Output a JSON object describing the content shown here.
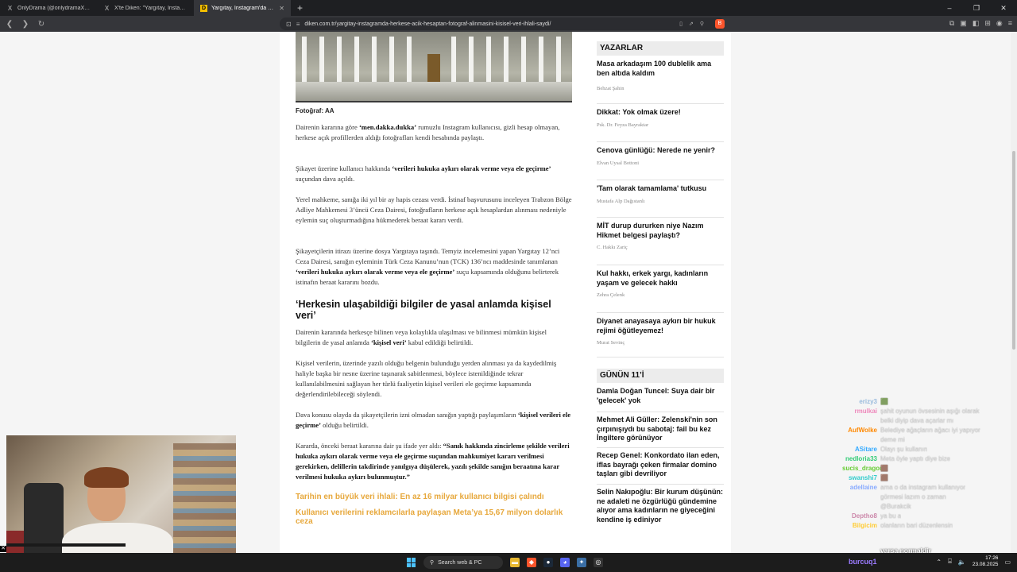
{
  "browser": {
    "tabs": [
      {
        "label": "OnlyDrama (@onlydramaX) / X",
        "icon": "X"
      },
      {
        "label": "X'te Diken: \"Yargıtay, Instagram'da h...",
        "icon": "X"
      },
      {
        "label": "Yargıtay, Instagram'da herkese a...",
        "icon": "D",
        "active": true
      }
    ],
    "new_tab": "+",
    "window_controls": [
      "–",
      "❐",
      "✕"
    ],
    "url": "diken.com.tr/yargitay-instagramda-herkese-acik-hesaptan-fotograf-alinmasini-kisisel-veri-ihlali-saydi/",
    "brave_badge": "B"
  },
  "article": {
    "photo_caption": "Fotoğraf: AA",
    "paragraphs": [
      {
        "pre": "Dairenin kararına göre ",
        "bold": "‘men.dakka.dukka’",
        "post": " rumuzlu Instagram kullanıcısı, gizli hesap olmayan, herkese açık profillerden aldığı fotoğrafları kendi hesabında paylaştı."
      },
      {
        "pre": "Şikayet üzerine kullanıcı hakkında ",
        "bold": "‘verileri hukuka aykırı olarak verme veya ele geçirme’",
        "post": " suçundan dava açıldı."
      },
      {
        "pre": "Yerel mahkeme, sanığa iki yıl bir ay hapis cezası verdi. İstinaf başvurusunu inceleyen Trabzon Bölge Adliye Mahkemesi 3’üncü Ceza Dairesi, fotoğrafların herkese açık hesaplardan alınması nedeniyle eylemin suç oluşturmadığına hükmederek beraat kararı verdi.",
        "bold": "",
        "post": ""
      },
      {
        "pre": "Şikayetçilerin itirazı üzerine dosya Yargıtaya taşındı. Temyiz incelemesini yapan Yargıtay 12’nci Ceza Dairesi, sanığın eyleminin Türk Ceza Kanunu’nun (TCK) 136’ncı maddesinde tanımlanan ",
        "bold": "‘verileri hukuka aykırı olarak verme veya ele geçirme’",
        "post": " suçu kapsamında olduğunu belirterek istinafın beraat kararını bozdu."
      }
    ],
    "heading": "‘Herkesin ulaşabildiği bilgiler de yasal anlamda kişisel veri’",
    "paragraphs2": [
      {
        "pre": "Dairenin kararında herkesçe bilinen veya kolaylıkla ulaşılması ve bilinmesi mümkün kişisel bilgilerin de yasal anlamda ",
        "bold": "‘kişisel veri’",
        "post": " kabul edildiği belirtildi."
      },
      {
        "pre": "Kişisel verilerin, üzerinde yazılı olduğu belgenin bulunduğu yerden alınması ya da kaydedilmiş haliyle başka bir nesne üzerine taşınarak sabitlenmesi, böylece istenildiğinde tekrar kullanılabilmesini sağlayan her türlü faaliyetin kişisel verileri ele geçirme kapsamında değerlendirilebileceği söylendi.",
        "bold": "",
        "post": ""
      },
      {
        "pre": "Dava konusu olayda da şikayetçilerin izni olmadan sanığın yaptığı paylaşımların ",
        "bold": "‘kişisel verileri ele geçirme’",
        "post": " olduğu belirtildi."
      },
      {
        "pre": "Karardа, önceki beraat kararına dair şu ifade yer aldı: ",
        "bold": "“Sanık hakkında zincirleme şekilde verileri hukuka aykırı olarak verme veya ele geçirme suçundan mahkumiyet kararı verilmesi gerekirken, delillerin takdirinde yanılgıya düşülerek, yazılı şekilde sanığın beraatına karar verilmesi hukuka aykırı bulunmuştur.”",
        "post": ""
      }
    ],
    "related": [
      "Tarihin en büyük veri ihlali: En az 16 milyar kullanıcı bilgisi çalındı",
      "Kullanıcı verilerini reklamcılarla paylaşan Meta’ya 15,67 milyon dolarlık ceza"
    ]
  },
  "sidebar": {
    "yazarlar_title": "YAZARLAR",
    "yazarlar": [
      {
        "title": "Masa arkadaşım 100 dublelik ama ben altıda kaldım",
        "author": "Behzat Şahin"
      },
      {
        "title": "Dikkat: Yok olmak üzere!",
        "author": "Psk. Dr. Feyza Bayraktar"
      },
      {
        "title": "Cenova günlüğü: Nerede ne yenir?",
        "author": "Elvan Uysal Bottoni"
      },
      {
        "title": "'Tam olarak tamamlama' tutkusu",
        "author": "Mustafa Alp Dağıstanlı"
      },
      {
        "title": "MİT durup dururken niye Nazım Hikmet belgesi paylaştı?",
        "author": "C. Hakkı Zariç"
      },
      {
        "title": "Kul hakkı, erkek yargı, kadınların yaşam ve gelecek hakkı",
        "author": "Zehra Çelenk"
      },
      {
        "title": "Diyanet anayasaya aykırı bir hukuk rejimi öğütleyemez!",
        "author": "Murat Sevinç"
      }
    ],
    "gunun_title": "GÜNÜN 11’İ",
    "gunun": [
      "Damla Doğan Tuncel: Suya dair bir 'gelecek' yok",
      "Mehmet Ali Güller: Zelenski'nin son çırpınışıydı bu sabotaj: fail bu kez İngiltere görünüyor",
      "Recep Genel: Konkordato ilan eden, iflas bayrağı çeken firmalar domino taşları gibi devriliyor",
      "Selin Nakıpoğlu: Bir kurum düşünün: ne adaleti ne özgürlüğü gündemine alıyor ama kadınların ne giyeceğini kendine iş ediniyor"
    ]
  },
  "chat": [
    {
      "name": "erizy3",
      "color": "#9bd",
      "text": "🟩"
    },
    {
      "name": "rmulkai",
      "color": "#e8b",
      "text": "şahit oyunun övsesinin aşığı olarak"
    },
    {
      "name": "",
      "color": "#e8b",
      "text": "belki diyip dava açarlar mı"
    },
    {
      "name": "AufWolke",
      "color": "#f80",
      "text": "Belediye ağaçların ağacı iyi yapıyor"
    },
    {
      "name": "",
      "color": "#f80",
      "text": "deme mi"
    },
    {
      "name": "ASitare",
      "color": "#3af",
      "text": "Olayı şu kullanın"
    },
    {
      "name": "nedloria33",
      "color": "#3c7",
      "text": "Meta öyle yaptı diye bize"
    },
    {
      "name": "sucis_dragon",
      "color": "#6c3",
      "text": "🟫"
    },
    {
      "name": "swanshi7",
      "color": "#3cc",
      "text": "🟫"
    },
    {
      "name": "adellaine",
      "color": "#8af",
      "text": "ama o da instagram kullanıyor"
    },
    {
      "name": "",
      "color": "#8af",
      "text": "görmesi lazım o zaman"
    },
    {
      "name": "",
      "color": "#8af",
      "text": "@Burakcik"
    },
    {
      "name": "Deptho8",
      "color": "#c8a",
      "text": "ya bu a"
    },
    {
      "name": "Bilgicim",
      "color": "#fc3",
      "text": "olanların bari düzenlensin"
    }
  ],
  "stream_overlay": "varsa normaldir",
  "stream_name": "burcuq1",
  "taskbar": {
    "search_placeholder": "Search web & PC",
    "time": "17:26",
    "date": "23.08.2025"
  }
}
